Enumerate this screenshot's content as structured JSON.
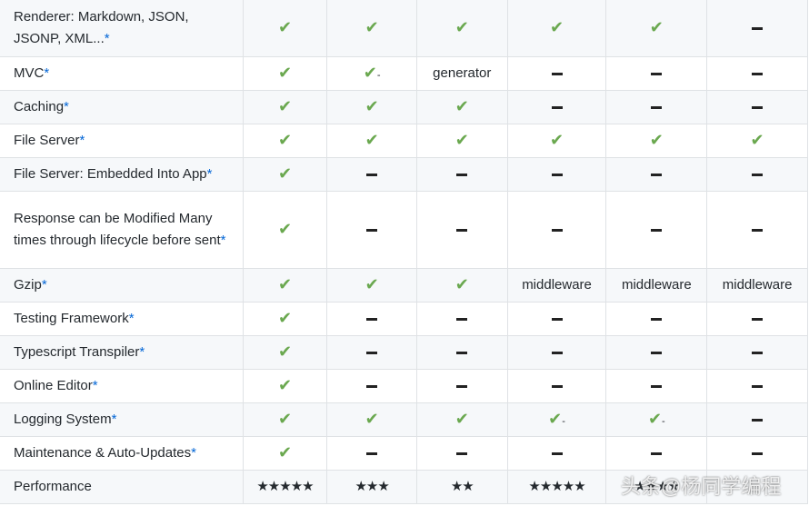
{
  "rows": [
    {
      "feature": "Renderer: Markdown, JSON, JSONP, XML...",
      "ast": "*",
      "cells": [
        "check",
        "check",
        "check",
        "check",
        "check",
        "dash"
      ]
    },
    {
      "feature": "MVC",
      "ast": "*",
      "cells": [
        "check",
        "check-",
        "generator",
        "dash",
        "dash",
        "dash"
      ]
    },
    {
      "feature": "Caching",
      "ast": "*",
      "cells": [
        "check",
        "check",
        "check",
        "dash",
        "dash",
        "dash"
      ]
    },
    {
      "feature": "File Server",
      "ast": "*",
      "cells": [
        "check",
        "check",
        "check",
        "check",
        "check",
        "check"
      ]
    },
    {
      "feature": "File Server: Embedded Into App",
      "ast": "*",
      "cells": [
        "check",
        "dash",
        "dash",
        "dash",
        "dash",
        "dash"
      ]
    },
    {
      "feature": "Response can be Modified Many times through lifecycle before sent",
      "ast": "*",
      "cells": [
        "check",
        "dash",
        "dash",
        "dash",
        "dash",
        "dash"
      ]
    },
    {
      "feature": "Gzip",
      "ast": "*",
      "cells": [
        "check",
        "check",
        "check",
        "middleware",
        "middleware",
        "middleware"
      ]
    },
    {
      "feature": "Testing Framework",
      "ast": "*",
      "cells": [
        "check",
        "dash",
        "dash",
        "dash",
        "dash",
        "dash"
      ]
    },
    {
      "feature": "Typescript Transpiler",
      "ast": "*",
      "cells": [
        "check",
        "dash",
        "dash",
        "dash",
        "dash",
        "dash"
      ]
    },
    {
      "feature": "Online Editor",
      "ast": "*",
      "cells": [
        "check",
        "dash",
        "dash",
        "dash",
        "dash",
        "dash"
      ]
    },
    {
      "feature": "Logging System",
      "ast": "*",
      "cells": [
        "check",
        "check",
        "check",
        "check-",
        "check-",
        "dash"
      ]
    },
    {
      "feature": "Maintenance & Auto-Updates",
      "ast": "*",
      "cells": [
        "check",
        "dash",
        "dash",
        "dash",
        "dash",
        "dash"
      ]
    },
    {
      "feature": "Performance",
      "ast": "",
      "cells": [
        "★★★★★",
        "★★★",
        "★★",
        "★★★★★",
        "★★★★",
        ""
      ]
    }
  ],
  "watermark": "头条@杨同学编程",
  "colors": {
    "check": "#6aa84f",
    "stripe": "#f6f8fa",
    "border": "#dfe2e5",
    "asterisk": "#0366d6"
  }
}
